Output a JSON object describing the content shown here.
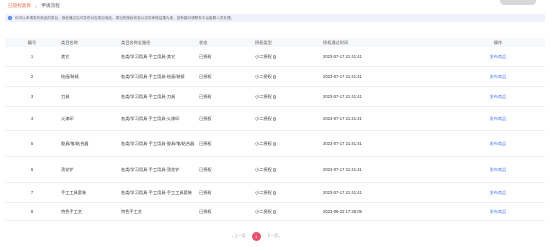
{
  "breadcrumb": {
    "parent": "已授权类目",
    "separator": ">",
    "current": "申请流程"
  },
  "notice": {
    "icon": "info-icon",
    "text": "你可以申请发布商品的类目，授权通过后可发布对应类目商品。类目的授权状态以实际审核结果为准，若有疑问请联系平台客服人员处理。"
  },
  "table": {
    "headers": [
      "编号",
      "类目名称",
      "类目名称全路径",
      "状态",
      "授权类型",
      "授权通过时间",
      "操作"
    ],
    "rows": [
      {
        "id": "1",
        "name": "其它",
        "path": "各类/学习用具·手工用具-其它",
        "status": "已授权",
        "type": "小二授权",
        "time": "2023-07-17 21:41:41",
        "op": "发布商品"
      },
      {
        "id": "2",
        "name": "绘画/装裱",
        "path": "各类/学习用具·手工用具-绘画/装裱",
        "status": "已授权",
        "type": "小二授权",
        "time": "2023-07-17 21:41:41",
        "op": "发布商品"
      },
      {
        "id": "3",
        "name": "刀具",
        "path": "各类/学习用具·手工用具-刀具",
        "status": "已授权",
        "type": "小二授权",
        "time": "2023-07-17 21:41:41",
        "op": "发布商品"
      },
      {
        "id": "4",
        "name": "火漆印",
        "path": "各类/学习用具·手工用具-火漆印",
        "status": "已授权",
        "type": "小二授权",
        "time": "2023-07-17 21:41:41",
        "op": "发布商品"
      },
      {
        "id": "5",
        "name": "胶具/笔/粘合器",
        "path": "各类/学习用具·手工用具-胶具/笔/粘合器",
        "status": "已授权",
        "type": "小二授权",
        "time": "2023-07-17 21:41:41",
        "op": "发布商品"
      },
      {
        "id": "6",
        "name": "烫花铲",
        "path": "各类/学习用具·手工用具-烫花铲",
        "status": "已授权",
        "type": "小二授权",
        "time": "2023-07-17 21:41:41",
        "op": "发布商品"
      },
      {
        "id": "7",
        "name": "手工工具套装",
        "path": "各类/学习用具·手工用具-手工工具套装",
        "status": "已授权",
        "type": "小二授权",
        "time": "2023-07-17 21:41:41",
        "op": "发布商品"
      },
      {
        "id": "8",
        "name": "特色手工艺",
        "path": "特色手工艺",
        "status": "已授权",
        "type": "小二授权",
        "time": "2023-06-22 17:36:09",
        "op": "发布商品"
      }
    ]
  },
  "pager": {
    "prev": "上一页",
    "current": "1",
    "next": "下一页"
  },
  "colors": {
    "accent": "#e8506b",
    "link": "#4a7cf0",
    "breadcrumb": "#e8704a"
  }
}
